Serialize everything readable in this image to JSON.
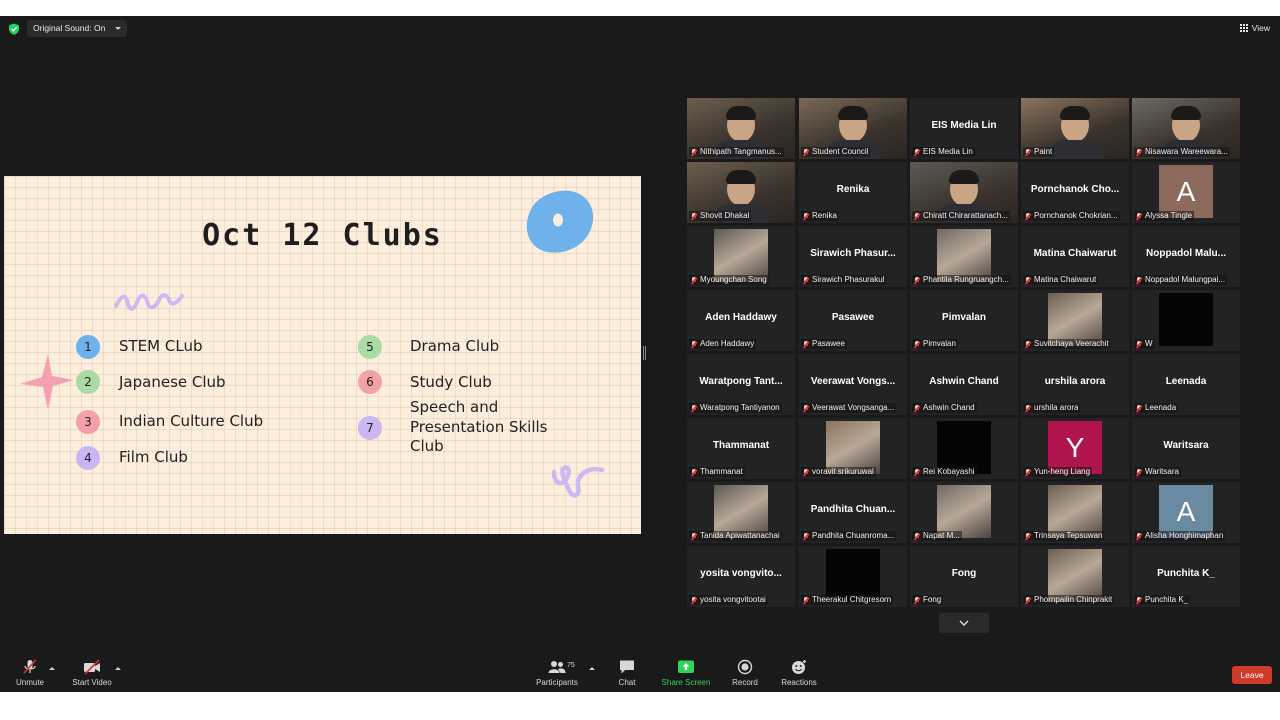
{
  "topbar": {
    "original_sound": "Original Sound: On",
    "view": "View",
    "shield_color": "#23d160"
  },
  "slide": {
    "title": "Oct 12 Clubs",
    "clubs_left": [
      {
        "num": "1",
        "label": "STEM CLub",
        "color": "#6fb1ea"
      },
      {
        "num": "2",
        "label": "Japanese Club",
        "color": "#a9dba3"
      },
      {
        "num": "3",
        "label": "Indian Culture Club",
        "color": "#f3a0a9"
      },
      {
        "num": "4",
        "label": "Film Club",
        "color": "#c9b6f2"
      }
    ],
    "clubs_right": [
      {
        "num": "5",
        "label": "Drama Club",
        "color": "#a9dba3"
      },
      {
        "num": "6",
        "label": "Study Club",
        "color": "#f3a0a9"
      },
      {
        "num": "7",
        "label": "Speech and Presentation Skills Club",
        "label_lines": [
          "Speech and",
          "Presentation Skills",
          "Club"
        ],
        "color": "#c9b6f2"
      }
    ]
  },
  "gallery": {
    "tiles": [
      {
        "label": "Nithipath Tangmanus...",
        "type": "video",
        "active": true
      },
      {
        "label": "Student Council",
        "type": "video"
      },
      {
        "label": "EIS Media Lin",
        "display_name": "EIS Media Lin",
        "type": "name"
      },
      {
        "label": "Paint",
        "type": "video"
      },
      {
        "label": "Nisawara Wareewara...",
        "type": "video"
      },
      {
        "label": "Shovit Dhakal",
        "type": "video"
      },
      {
        "label": "Renika",
        "display_name": "Renika",
        "type": "name"
      },
      {
        "label": "Chiratt Chirarattanach...",
        "type": "video"
      },
      {
        "label": "Pornchanok Chokrian...",
        "display_name": "Pornchanok  Cho...",
        "type": "name"
      },
      {
        "label": "Alyssa Tingle",
        "avatar": "A",
        "avatar_color": "#8c6a5c",
        "type": "avatar"
      },
      {
        "label": "Myoungchan Song",
        "type": "thumb"
      },
      {
        "label": "Sirawich Phasurakul",
        "display_name": "Sirawich  Phasur...",
        "type": "name"
      },
      {
        "label": "Phantila Rungruangch...",
        "type": "thumb"
      },
      {
        "label": "Matina Chaiwarut",
        "display_name": "Matina Chaiwarut",
        "type": "name"
      },
      {
        "label": "Noppadol Malungpai...",
        "display_name": "Noppadol  Malu...",
        "type": "name"
      },
      {
        "label": "Aden Haddawy",
        "display_name": "Aden Haddawy",
        "type": "name"
      },
      {
        "label": "Pasawee",
        "display_name": "Pasawee",
        "type": "name"
      },
      {
        "label": "Pimvalan",
        "display_name": "Pimvalan",
        "type": "name"
      },
      {
        "label": "Suvitchaya Veerachit",
        "type": "thumb"
      },
      {
        "label": "W",
        "type": "black"
      },
      {
        "label": "Waratpong Tantiyanon",
        "display_name": "Waratpong  Tant...",
        "type": "name"
      },
      {
        "label": "Veerawat Vongsanga...",
        "display_name": "Veerawat  Vongs...",
        "type": "name"
      },
      {
        "label": "Ashwin Chand",
        "display_name": "Ashwin Chand",
        "type": "name"
      },
      {
        "label": "urshila arora",
        "display_name": "urshila arora",
        "type": "name"
      },
      {
        "label": "Leenada",
        "display_name": "Leenada",
        "type": "name"
      },
      {
        "label": "Thammanat",
        "display_name": "Thammanat",
        "type": "name"
      },
      {
        "label": "voravit srikuruwal",
        "type": "thumb"
      },
      {
        "label": "Rei Kobayashi",
        "type": "black"
      },
      {
        "label": "Yun-heng Liang",
        "avatar": "Y",
        "avatar_color": "#b0144f",
        "type": "avatar"
      },
      {
        "label": "Waritsara",
        "display_name": "Waritsara",
        "type": "name"
      },
      {
        "label": "Tanida Apiwattanachai",
        "type": "thumb"
      },
      {
        "label": "Pandhita Chuanroma...",
        "display_name": "Pandhita  Chuan...",
        "type": "name"
      },
      {
        "label": "Napat M...",
        "type": "thumb"
      },
      {
        "label": "Trinsaya Tepsuwan",
        "type": "thumb"
      },
      {
        "label": "Alisha Honghimaphan",
        "avatar": "A",
        "avatar_color": "#6a8aa2",
        "type": "avatar"
      },
      {
        "label": "yosita vongvitootai",
        "display_name": "yosita  vongvito...",
        "type": "name"
      },
      {
        "label": "Theerakul Chitgresorn",
        "type": "black"
      },
      {
        "label": "Fong",
        "display_name": "Fong",
        "type": "name"
      },
      {
        "label": "Phornpailin Chinprakit",
        "type": "thumb"
      },
      {
        "label": "Punchita K_",
        "display_name": "Punchita K_",
        "type": "name"
      }
    ]
  },
  "toolbar": {
    "unmute": "Unmute",
    "start_video": "Start Video",
    "participants": "Participants",
    "participants_count": "75",
    "chat": "Chat",
    "share_screen": "Share Screen",
    "record": "Record",
    "reactions": "Reactions",
    "leave": "Leave",
    "share_color": "#2fd25a",
    "leave_color": "#d03a2c"
  }
}
